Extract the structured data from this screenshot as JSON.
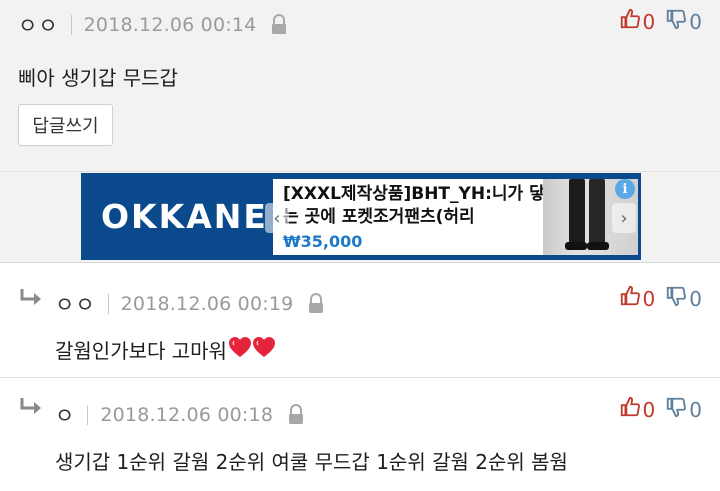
{
  "comments": [
    {
      "nick": "ㅇㅇ",
      "date": "2018.12.06 00:14",
      "text": "삐아 생기갑 무드갑",
      "upvotes": "0",
      "downvotes": "0",
      "reply_button": "답글쓰기"
    },
    {
      "nick": "ㅇㅇ",
      "date": "2018.12.06 00:19",
      "text": "갈웜인가보다 고마워",
      "upvotes": "0",
      "downvotes": "0"
    },
    {
      "nick": "ㅇ",
      "date": "2018.12.06 00:18",
      "text": "생기갑 1순위 갈웜 2순위 여쿨 무드갑 1순위 갈웜 2순위 봄웜",
      "upvotes": "0",
      "downvotes": "0"
    }
  ],
  "ad": {
    "brand": "OKKANE",
    "title": "[XXXL제작상품]BHT_YH:니가 닿는 곳에 포켓조거팬츠(허리",
    "price": "₩35,000",
    "info_glyph": "i"
  },
  "colors": {
    "upvote": "#c0392b",
    "downvote": "#5f7f9a",
    "ad_background": "#0a4a8c",
    "price": "#1f79c8",
    "heart": "#e5243b"
  },
  "icons": {
    "lock": "lock-icon",
    "thumb_up": "thumbs-up-icon",
    "thumb_down": "thumbs-down-icon",
    "reply": "reply-arrow-icon",
    "heart": "heart-icon"
  }
}
